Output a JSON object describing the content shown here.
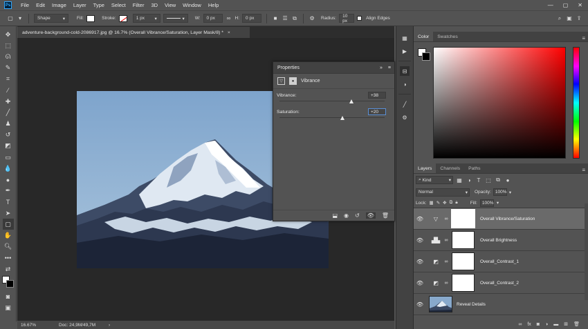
{
  "menubar": {
    "logo": "Ps",
    "items": [
      "File",
      "Edit",
      "Image",
      "Layer",
      "Type",
      "Select",
      "Filter",
      "3D",
      "View",
      "Window",
      "Help"
    ],
    "window_controls": [
      "—",
      "▢",
      "✕"
    ]
  },
  "options": {
    "mode": "Shape",
    "fill_label": "Fill:",
    "stroke_label": "Stroke:",
    "stroke_width": "1 px",
    "w_label": "W:",
    "w_value": "0 px",
    "h_label": "H:",
    "h_value": "0 px",
    "radius_label": "Radius:",
    "radius_value": "10 px",
    "align_edges": "Align Edges"
  },
  "document": {
    "tab_title": "adventure-background-cold-2086917.jpg @ 16.7% (Overall Vibrance/Saturation, Layer Mask/8) *",
    "close": "×",
    "zoom": "16.67%",
    "doc_info": "Doc: 24,9M/49,7M",
    "status_arrow": "›"
  },
  "properties": {
    "panel_title": "Properties",
    "layer_type": "Vibrance",
    "vibrance_label": "Vibrance:",
    "vibrance_value": "+38",
    "vibrance_level": 0.69,
    "saturation_label": "Saturation:",
    "saturation_value": "+20",
    "saturation_level": 0.6
  },
  "color_panel": {
    "tabs": [
      "Color",
      "Swatches"
    ]
  },
  "layers_panel": {
    "tabs": [
      "Layers",
      "Channels",
      "Paths"
    ],
    "kind": "Kind",
    "blend_mode": "Normal",
    "opacity_label": "Opacity:",
    "opacity_value": "100%",
    "lock_label": "Lock:",
    "fill_label": "Fill:",
    "fill_value": "100%",
    "layers": [
      {
        "name": "Overall Vibrance/Saturation",
        "icon": "vibrance-icon",
        "selected": true
      },
      {
        "name": "Overall Brightness",
        "icon": "levels-icon",
        "selected": false
      },
      {
        "name": "Overall_Contrast_1",
        "icon": "curves-icon",
        "selected": false
      },
      {
        "name": "Overall_Contrast_2",
        "icon": "curves-icon",
        "selected": false
      },
      {
        "name": "Reveal Details",
        "icon": "image-thumbnail",
        "selected": false
      }
    ],
    "footer_fx": "fx"
  },
  "colors": {
    "ui_dark": "#535353",
    "canvas_bg": "#282828",
    "accent": "#31a8ff"
  }
}
